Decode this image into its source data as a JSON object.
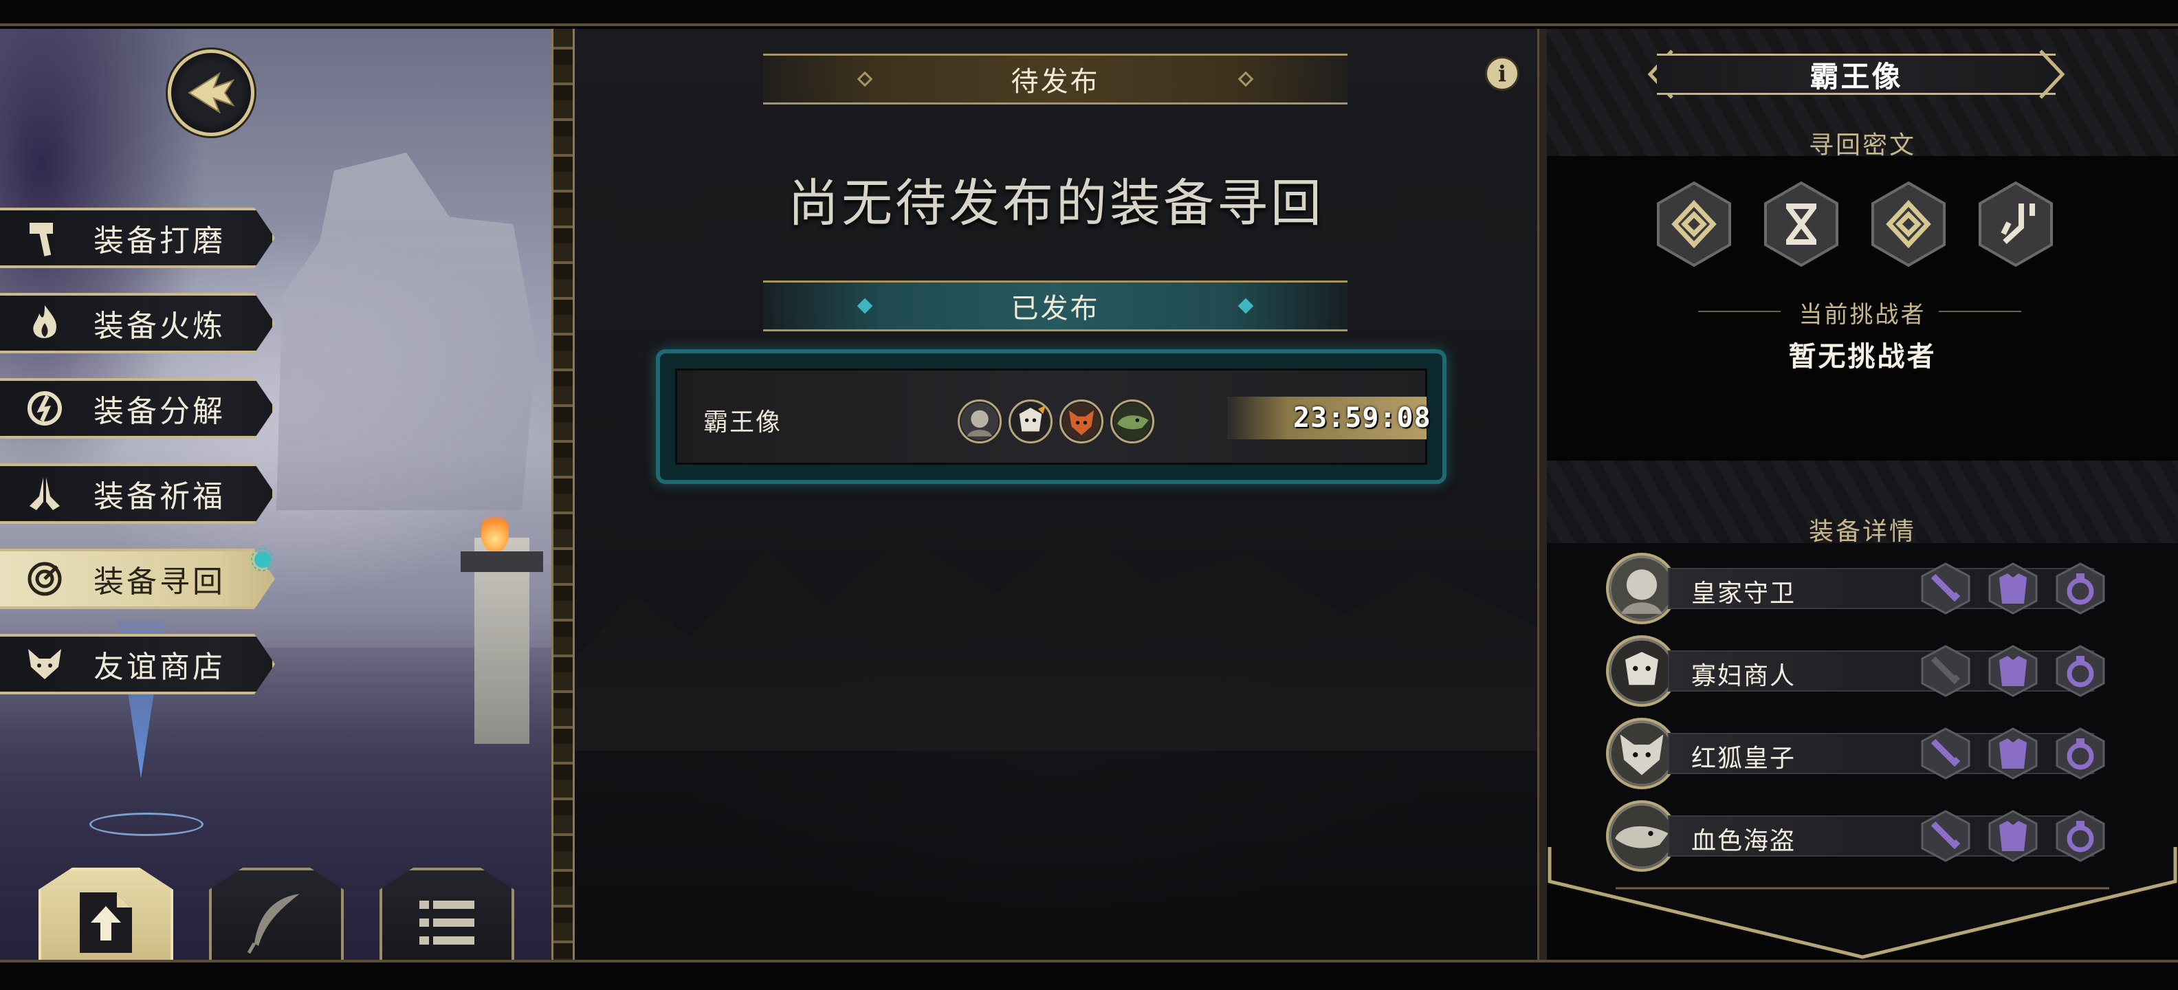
{
  "left_menu": {
    "back_icon": "back-arrow-icon",
    "items": [
      {
        "label": "装备打磨",
        "icon": "hammer-icon",
        "active": false
      },
      {
        "label": "装备火炼",
        "icon": "flame-icon",
        "active": false
      },
      {
        "label": "装备分解",
        "icon": "decompose-icon",
        "active": false
      },
      {
        "label": "装备祈福",
        "icon": "praying-hands-icon",
        "active": false
      },
      {
        "label": "装备寻回",
        "icon": "target-icon",
        "active": true
      },
      {
        "label": "友谊商店",
        "icon": "fox-icon",
        "active": false
      }
    ],
    "bottom_tabs": [
      {
        "icon": "upload-file-icon",
        "active": true
      },
      {
        "icon": "feather-icon",
        "active": false
      },
      {
        "icon": "list-icon",
        "active": false
      }
    ]
  },
  "pending": {
    "header": "待发布",
    "empty_text": "尚无待发布的装备寻回"
  },
  "published": {
    "header": "已发布",
    "items": [
      {
        "name": "霸王像",
        "timer": "23:59:08",
        "avatars": [
          "challenger-avatar-1",
          "challenger-avatar-2",
          "challenger-avatar-3",
          "challenger-avatar-4"
        ]
      }
    ]
  },
  "info_icon": "info-icon",
  "detail": {
    "title": "霸王像",
    "runes_title": "寻回密文",
    "runes": [
      "rune-spiral-icon",
      "rune-hourglass-icon",
      "rune-spiral-icon",
      "rune-branch-icon"
    ],
    "challenger_label": "当前挑战者",
    "challenger_value": "暂无挑战者",
    "equipment_title": "装备详情",
    "equipment": [
      {
        "name": "皇家守卫",
        "weapon": true,
        "armor": true,
        "ring": true
      },
      {
        "name": "寡妇商人",
        "weapon": false,
        "armor": true,
        "ring": true
      },
      {
        "name": "红狐皇子",
        "weapon": true,
        "armor": true,
        "ring": true
      },
      {
        "name": "血色海盗",
        "weapon": true,
        "armor": true,
        "ring": true
      }
    ]
  },
  "colors": {
    "gold": "#cbb98c",
    "teal": "#1f6a72",
    "purple_slot": "#8b6fc7",
    "active_menu": "#e0d5ab"
  }
}
